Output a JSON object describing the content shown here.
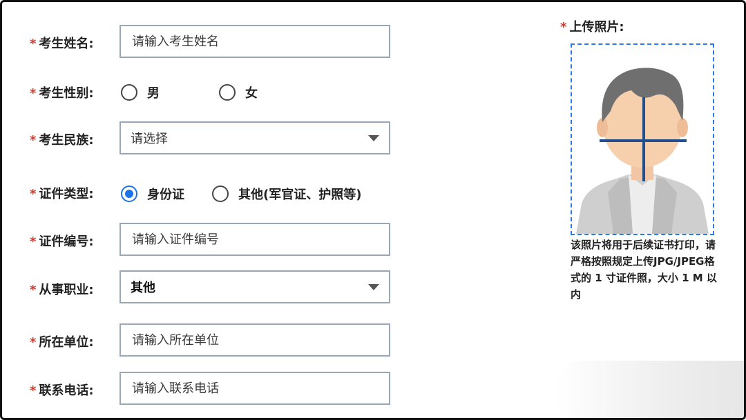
{
  "form": {
    "required_mark": "*",
    "name": {
      "label": "考生姓名:",
      "placeholder": "请输入考生姓名"
    },
    "gender": {
      "label": "考生性别:",
      "options": [
        "男",
        "女"
      ]
    },
    "ethnicity": {
      "label": "考生民族:",
      "value": "请选择"
    },
    "id_type": {
      "label": "证件类型:",
      "options": [
        "身份证",
        "其他(军官证、护照等)"
      ],
      "selected": "身份证"
    },
    "id_number": {
      "label": "证件编号:",
      "placeholder": "请输入证件编号"
    },
    "occupation": {
      "label": "从事职业:",
      "value": "其他"
    },
    "workplace": {
      "label": "所在单位:",
      "placeholder": "请输入所在单位"
    },
    "phone": {
      "label": "联系电话:",
      "placeholder": "请输入联系电话"
    }
  },
  "photo": {
    "label": "上传照片:",
    "note": "该照片将用于后续证书打印，请严格按照规定上传JPG/JPEG格式的 1 寸证件照，大小 1 M 以内",
    "icon": "person-silhouette-icon",
    "accent": "#2a7be4"
  },
  "colors": {
    "required": "#d9362b",
    "radio_checked": "#1a73e8",
    "border": "#9aa7b6"
  }
}
